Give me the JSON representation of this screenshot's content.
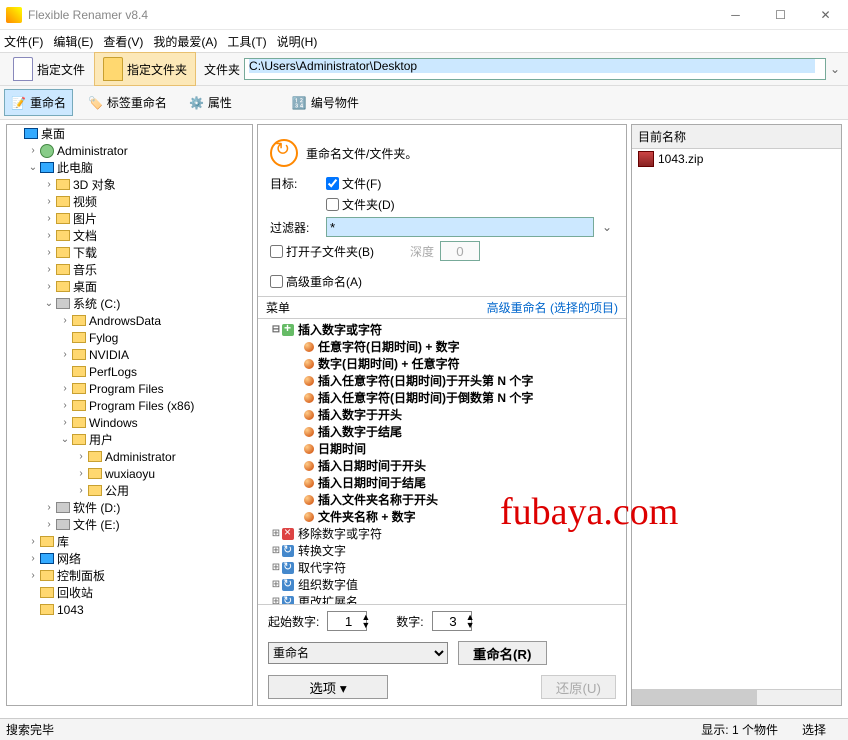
{
  "title": "Flexible Renamer v8.4",
  "menubar": [
    "文件(F)",
    "编辑(E)",
    "查看(V)",
    "我的最爱(A)",
    "工具(T)",
    "说明(H)"
  ],
  "toolbar1": {
    "specify_file": "指定文件",
    "specify_folder": "指定文件夹",
    "folder_label": "文件夹",
    "path": "C:\\Users\\Administrator\\Desktop"
  },
  "toolbar2": {
    "rename": "重命名",
    "tag_rename": "标签重命名",
    "attributes": "属性",
    "number_objects": "编号物件"
  },
  "tree": [
    {
      "d": 0,
      "exp": "",
      "icon": "pc",
      "label": "桌面"
    },
    {
      "d": 1,
      "exp": ">",
      "icon": "usr",
      "label": "Administrator"
    },
    {
      "d": 1,
      "exp": "v",
      "icon": "pc",
      "label": "此电脑"
    },
    {
      "d": 2,
      "exp": ">",
      "icon": "fld",
      "label": "3D 对象"
    },
    {
      "d": 2,
      "exp": ">",
      "icon": "fld",
      "label": "视频"
    },
    {
      "d": 2,
      "exp": ">",
      "icon": "fld",
      "label": "图片"
    },
    {
      "d": 2,
      "exp": ">",
      "icon": "fld",
      "label": "文档"
    },
    {
      "d": 2,
      "exp": ">",
      "icon": "fld",
      "label": "下载"
    },
    {
      "d": 2,
      "exp": ">",
      "icon": "fld",
      "label": "音乐"
    },
    {
      "d": 2,
      "exp": ">",
      "icon": "fld",
      "label": "桌面"
    },
    {
      "d": 2,
      "exp": "v",
      "icon": "drv",
      "label": "系统 (C:)"
    },
    {
      "d": 3,
      "exp": ">",
      "icon": "fld",
      "label": "AndrowsData"
    },
    {
      "d": 3,
      "exp": "",
      "icon": "fld",
      "label": "Fylog"
    },
    {
      "d": 3,
      "exp": ">",
      "icon": "fld",
      "label": "NVIDIA"
    },
    {
      "d": 3,
      "exp": "",
      "icon": "fld",
      "label": "PerfLogs"
    },
    {
      "d": 3,
      "exp": ">",
      "icon": "fld",
      "label": "Program Files"
    },
    {
      "d": 3,
      "exp": ">",
      "icon": "fld",
      "label": "Program Files (x86)"
    },
    {
      "d": 3,
      "exp": ">",
      "icon": "fld",
      "label": "Windows"
    },
    {
      "d": 3,
      "exp": "v",
      "icon": "fld",
      "label": "用户"
    },
    {
      "d": 4,
      "exp": ">",
      "icon": "fld",
      "label": "Administrator"
    },
    {
      "d": 4,
      "exp": ">",
      "icon": "fld",
      "label": "wuxiaoyu"
    },
    {
      "d": 4,
      "exp": ">",
      "icon": "fld",
      "label": "公用"
    },
    {
      "d": 2,
      "exp": ">",
      "icon": "drv",
      "label": "软件 (D:)"
    },
    {
      "d": 2,
      "exp": ">",
      "icon": "drv",
      "label": "文件 (E:)"
    },
    {
      "d": 1,
      "exp": ">",
      "icon": "fld",
      "label": "库"
    },
    {
      "d": 1,
      "exp": ">",
      "icon": "pc",
      "label": "网络"
    },
    {
      "d": 1,
      "exp": ">",
      "icon": "fld",
      "label": "控制面板"
    },
    {
      "d": 1,
      "exp": "",
      "icon": "fld",
      "label": "回收站"
    },
    {
      "d": 1,
      "exp": "",
      "icon": "fld",
      "label": "1043"
    }
  ],
  "mid": {
    "heading": "重命名文件/文件夹。",
    "target_label": "目标:",
    "target_file": "文件(F)",
    "target_folder": "文件夹(D)",
    "filter_label": "过滤器:",
    "filter_value": "*",
    "open_sub": "打开子文件夹(B)",
    "depth_label": "深度",
    "depth_value": "0",
    "adv_rename": "高级重命名(A)",
    "menu_label": "菜单",
    "adv_link": "高级重命名 (选择的项目)"
  },
  "menu_tree": [
    {
      "d": 0,
      "exp": "v",
      "icon": "plus",
      "label": "插入数字或字符",
      "b": true
    },
    {
      "d": 1,
      "exp": "",
      "icon": "bullet",
      "label": "任意字符(日期时间) + 数字",
      "b": true
    },
    {
      "d": 1,
      "exp": "",
      "icon": "bullet",
      "label": "数字(日期时间) + 任意字符",
      "b": true
    },
    {
      "d": 1,
      "exp": "",
      "icon": "bullet",
      "label": "插入任意字符(日期时间)于开头第 N 个字",
      "b": true
    },
    {
      "d": 1,
      "exp": "",
      "icon": "bullet",
      "label": "插入任意字符(日期时间)于倒数第 N 个字",
      "b": true
    },
    {
      "d": 1,
      "exp": "",
      "icon": "bullet",
      "label": "插入数字于开头",
      "b": true
    },
    {
      "d": 1,
      "exp": "",
      "icon": "bullet",
      "label": "插入数字于结尾",
      "b": true
    },
    {
      "d": 1,
      "exp": "",
      "icon": "bullet",
      "label": "日期时间",
      "b": true
    },
    {
      "d": 1,
      "exp": "",
      "icon": "bullet",
      "label": "插入日期时间于开头",
      "b": true
    },
    {
      "d": 1,
      "exp": "",
      "icon": "bullet",
      "label": "插入日期时间于结尾",
      "b": true
    },
    {
      "d": 1,
      "exp": "",
      "icon": "bullet",
      "label": "插入文件夹名称于开头",
      "b": true
    },
    {
      "d": 1,
      "exp": "",
      "icon": "bullet",
      "label": "文件夹名称 + 数字",
      "b": true
    },
    {
      "d": 0,
      "exp": ">",
      "icon": "x",
      "label": "移除数字或字符",
      "b": false
    },
    {
      "d": 0,
      "exp": ">",
      "icon": "arr",
      "label": "转换文字",
      "b": false
    },
    {
      "d": 0,
      "exp": ">",
      "icon": "arr",
      "label": "取代字符",
      "b": false
    },
    {
      "d": 0,
      "exp": ">",
      "icon": "arr",
      "label": "组织数字值",
      "b": false
    },
    {
      "d": 0,
      "exp": ">",
      "icon": "arr",
      "label": "更改扩展名",
      "b": false
    }
  ],
  "bottom": {
    "start_num_label": "起始数字:",
    "start_num": "1",
    "digits_label": "数字:",
    "digits": "3",
    "action_select": "重命名",
    "rename_btn": "重命名(R)",
    "options_btn": "选项",
    "restore_btn": "还原(U)"
  },
  "right": {
    "header": "目前名称",
    "item": "1043.zip"
  },
  "status": {
    "left": "搜索完毕",
    "show": "显示:",
    "count": "1 个物件",
    "select": "选择"
  },
  "watermark": "fubaya.com"
}
